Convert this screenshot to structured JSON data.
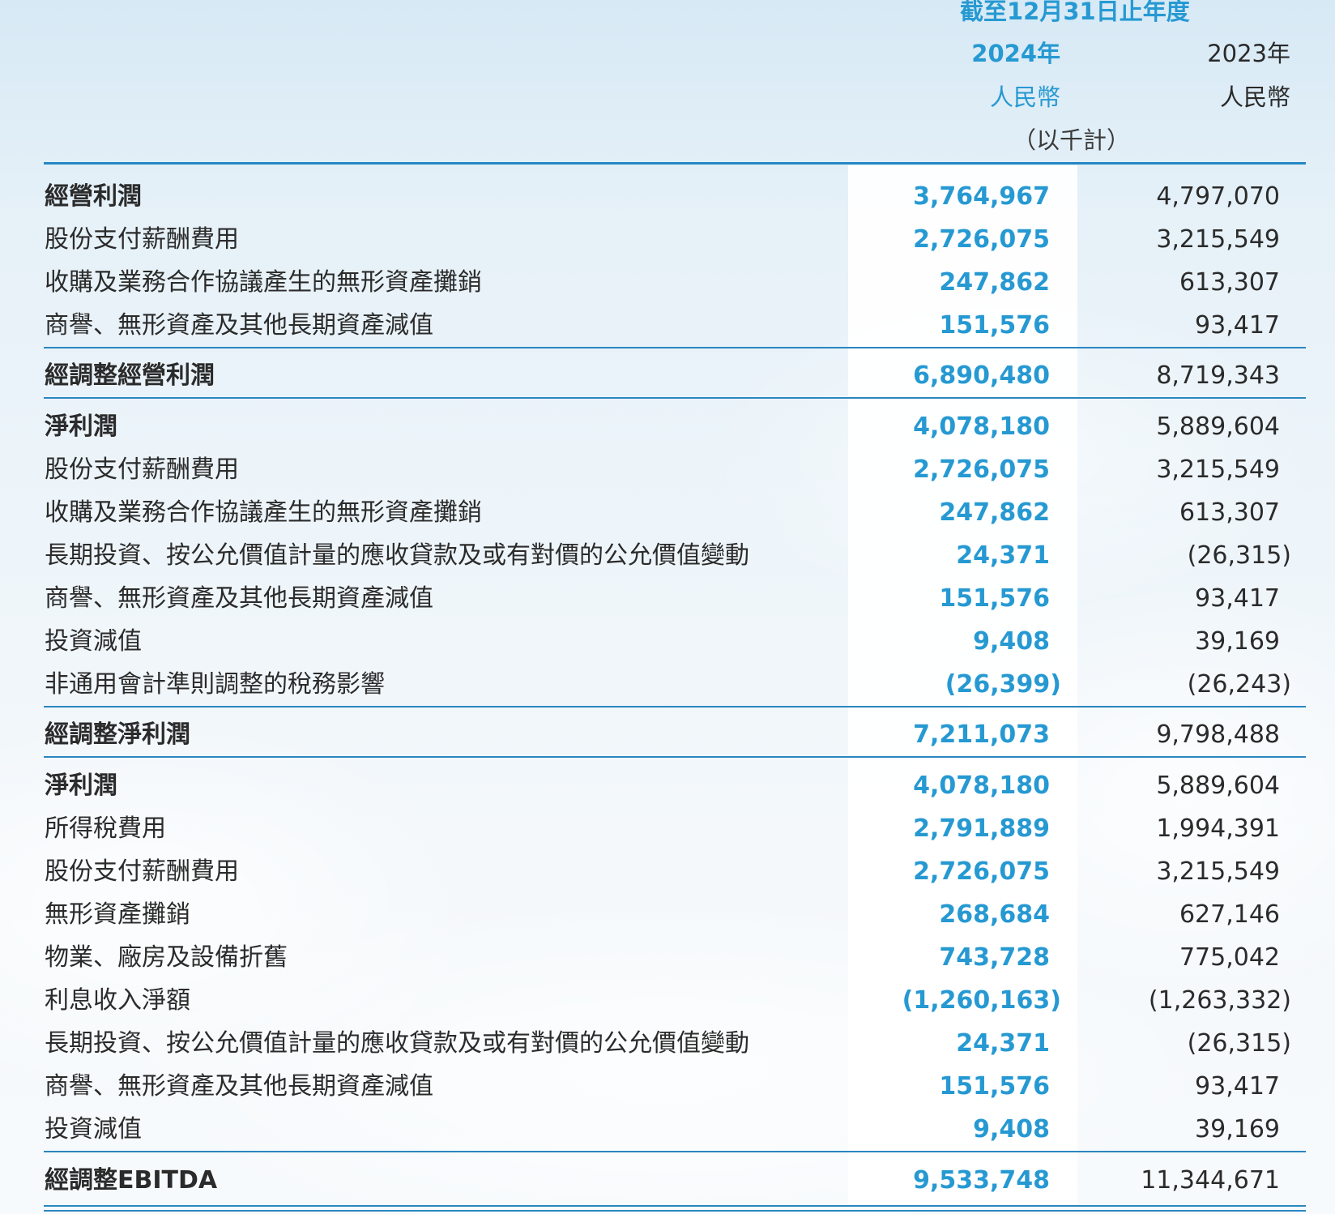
{
  "header": {
    "period": "截至12月31日止年度",
    "year_current": "2024年",
    "year_prior": "2023年",
    "currency_current": "人民幣",
    "currency_prior": "人民幣",
    "unit": "（以千計）"
  },
  "colors": {
    "accent": "#2699d2",
    "rule": "#2487c4"
  },
  "rows": [
    {
      "label": "經營利潤",
      "v2024": "3,764,967",
      "v2023": "4,797,070",
      "bold": true
    },
    {
      "label": "股份支付薪酬費用",
      "v2024": "2,726,075",
      "v2023": "3,215,549"
    },
    {
      "label": "收購及業務合作協議產生的無形資產攤銷",
      "v2024": "247,862",
      "v2023": "613,307"
    },
    {
      "label": "商譽、無形資產及其他長期資產減值",
      "v2024": "151,576",
      "v2023": "93,417"
    },
    {
      "label": "經調整經營利潤",
      "v2024": "6,890,480",
      "v2023": "8,719,343",
      "bold": true
    },
    {
      "label": "淨利潤",
      "v2024": "4,078,180",
      "v2023": "5,889,604",
      "bold": true
    },
    {
      "label": "股份支付薪酬費用",
      "v2024": "2,726,075",
      "v2023": "3,215,549"
    },
    {
      "label": "收購及業務合作協議產生的無形資產攤銷",
      "v2024": "247,862",
      "v2023": "613,307"
    },
    {
      "label": "長期投資、按公允價值計量的應收貸款及或有對價的公允價值變動",
      "v2024": "24,371",
      "v2023": "(26,315)"
    },
    {
      "label": "商譽、無形資產及其他長期資產減值",
      "v2024": "151,576",
      "v2023": "93,417"
    },
    {
      "label": "投資減值",
      "v2024": "9,408",
      "v2023": "39,169"
    },
    {
      "label": "非通用會計準則調整的稅務影響",
      "v2024": "(26,399)",
      "v2023": "(26,243)"
    },
    {
      "label": "經調整淨利潤",
      "v2024": "7,211,073",
      "v2023": "9,798,488",
      "bold": true
    },
    {
      "label": "淨利潤",
      "v2024": "4,078,180",
      "v2023": "5,889,604",
      "bold": true
    },
    {
      "label": "所得稅費用",
      "v2024": "2,791,889",
      "v2023": "1,994,391"
    },
    {
      "label": "股份支付薪酬費用",
      "v2024": "2,726,075",
      "v2023": "3,215,549"
    },
    {
      "label": "無形資產攤銷",
      "v2024": "268,684",
      "v2023": "627,146"
    },
    {
      "label": "物業、廠房及設備折舊",
      "v2024": "743,728",
      "v2023": "775,042"
    },
    {
      "label": "利息收入淨額",
      "v2024": "(1,260,163)",
      "v2023": "(1,263,332)"
    },
    {
      "label": "長期投資、按公允價值計量的應收貸款及或有對價的公允價值變動",
      "v2024": "24,371",
      "v2023": "(26,315)"
    },
    {
      "label": "商譽、無形資產及其他長期資產減值",
      "v2024": "151,576",
      "v2023": "93,417"
    },
    {
      "label": "投資減值",
      "v2024": "9,408",
      "v2023": "39,169"
    },
    {
      "label": "經調整EBITDA",
      "v2024": "9,533,748",
      "v2023": "11,344,671",
      "bold": true
    }
  ]
}
